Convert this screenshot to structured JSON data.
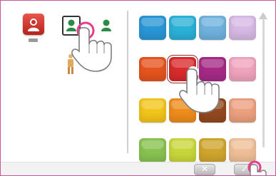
{
  "avatar_panel": {
    "current_avatar_icon": "user-avatar-icon",
    "current_color": "#d9362f",
    "options": [
      {
        "icon": "user-avatar-icon",
        "selected": true
      },
      {
        "icon": "user-avatar-icon",
        "selected": false
      }
    ],
    "figure_icon": "person-figure-icon"
  },
  "palette": {
    "rows": [
      [
        "#2a96d6",
        "#2ab1d8",
        "#6fb2de",
        "#d7b9e4"
      ],
      [
        "#e5541f",
        "#d92b2b",
        "#a52a86",
        "#efa3bd"
      ],
      [
        "#f2c51a",
        "#ee8c1c",
        "#93491e",
        "#eba07e"
      ],
      [
        "#88c250",
        "#c7d73a",
        "#cfa52d",
        "#efbf98"
      ]
    ],
    "selected": {
      "row": 1,
      "col": 1
    }
  },
  "buttons": {
    "cancel_label": "✕",
    "confirm_label": "✓"
  },
  "overlay": {
    "hand_icon": "pointing-hand-cursor-icon"
  }
}
